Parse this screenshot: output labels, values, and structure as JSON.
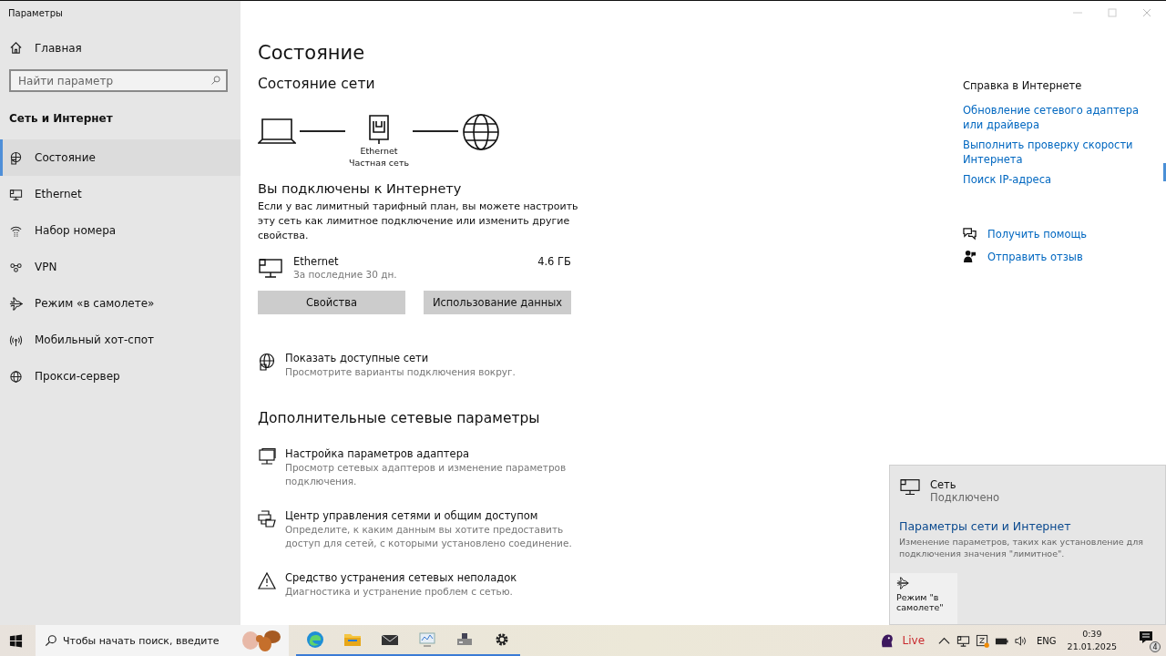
{
  "window": {
    "title": "Параметры"
  },
  "sidebar": {
    "home": "Главная",
    "search": {
      "placeholder": "Найти параметр"
    },
    "section": "Сеть и Интернет",
    "items": [
      {
        "label": "Состояние",
        "kind": "status",
        "selected": true
      },
      {
        "label": "Ethernet",
        "kind": "ethernet",
        "selected": false
      },
      {
        "label": "Набор номера",
        "kind": "dialup",
        "selected": false
      },
      {
        "label": "VPN",
        "kind": "vpn",
        "selected": false
      },
      {
        "label": "Режим «в самолете»",
        "kind": "airplane",
        "selected": false
      },
      {
        "label": "Мобильный хот-спот",
        "kind": "hotspot",
        "selected": false
      },
      {
        "label": "Прокси-сервер",
        "kind": "proxy",
        "selected": false
      }
    ]
  },
  "main": {
    "title": "Состояние",
    "subtitle": "Состояние сети",
    "diagram": {
      "adapter": "Ethernet",
      "network": "Частная сеть"
    },
    "connected_title": "Вы подключены к Интернету",
    "connected_text": "Если у вас лимитный тарифный план, вы можете настроить эту сеть как лимитное подключение или изменить другие свойства.",
    "usage": {
      "name": "Ethernet",
      "period": "За последние 30 дн.",
      "amount": "4.6 ГБ"
    },
    "buttons": [
      "Свойства",
      "Использование данных"
    ],
    "show_networks": {
      "title": "Показать доступные сети",
      "text": "Просмотрите варианты подключения вокруг."
    },
    "advanced_title": "Дополнительные сетевые параметры",
    "advanced": [
      {
        "title": "Настройка параметров адаптера",
        "text": "Просмотр сетевых адаптеров и изменение параметров подключения.",
        "kind": "adapter"
      },
      {
        "title": "Центр управления сетями и общим доступом",
        "text": "Определите, к каким данным вы хотите предоставить доступ для сетей, с которыми установлено соединение.",
        "kind": "sharing"
      },
      {
        "title": "Средство устранения сетевых неполадок",
        "text": "Диагностика и устранение проблем с сетью.",
        "kind": "warning"
      }
    ]
  },
  "help": {
    "title": "Справка в Интернете",
    "links": [
      "Обновление сетевого адаптера или драйвера",
      "Выполнить проверку скорости Интернета",
      "Поиск IP-адреса"
    ],
    "actions": [
      {
        "label": "Получить помощь",
        "kind": "help"
      },
      {
        "label": "Отправить отзыв",
        "kind": "feedback"
      }
    ]
  },
  "flyout": {
    "network": "Сеть",
    "status": "Подключено",
    "link": "Параметры сети и Интернет",
    "link_text": "Изменение параметров, таких как установление для подключения значения \"лимитное\".",
    "tile": "Режим \"в самолете\""
  },
  "taskbar": {
    "search": {
      "placeholder": "Чтобы начать поиск, введите"
    },
    "apps": [
      {
        "kind": "browser",
        "running": true
      },
      {
        "kind": "folder",
        "running": true
      },
      {
        "kind": "mail",
        "running": true
      },
      {
        "kind": "monitor",
        "running": true
      },
      {
        "kind": "drive",
        "running": true
      },
      {
        "kind": "gear",
        "running": true
      }
    ],
    "live": "Live",
    "language": "ENG",
    "time": "0:39",
    "date": "21.01.2025",
    "notifications": "4"
  }
}
